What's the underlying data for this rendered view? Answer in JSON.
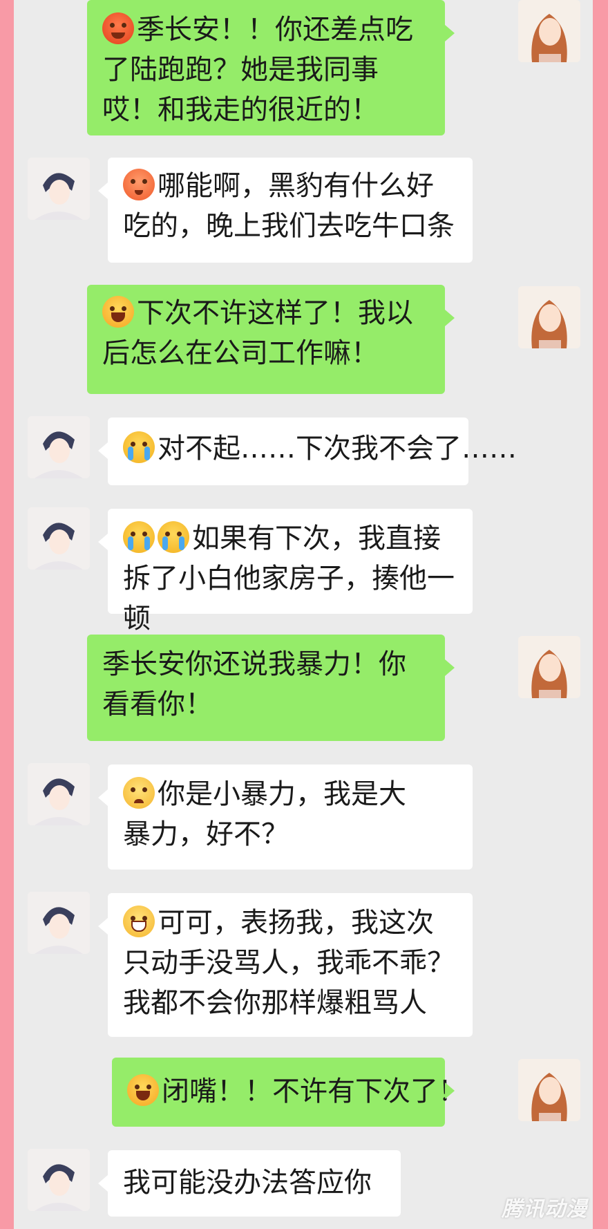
{
  "colors": {
    "sent_bubble": "#95ec69",
    "received_bubble": "#ffffff",
    "chat_background": "#ebebeb",
    "side_border": "#f89aa6"
  },
  "messages": [
    {
      "sender": "me",
      "emoji": "angry-face-icon",
      "text": "季长安！！你还差点吃了陆跑跑？她是我同事哎！和我走的很近的！"
    },
    {
      "sender": "them",
      "emoji": "flushed-face-icon",
      "text": "哪能啊，黑豹有什么好吃的，晚上我们去吃牛口条"
    },
    {
      "sender": "me",
      "emoji": "shouting-face-icon",
      "text": "下次不许这样了！我以后怎么在公司工作嘛！"
    },
    {
      "sender": "them",
      "emoji": "crying-face-icon",
      "text": "对不起……下次我不会了……"
    },
    {
      "sender": "them",
      "emoji": "crying-face-icon-pair",
      "text": "如果有下次，我直接拆了小白他家房子，揍他一顿"
    },
    {
      "sender": "me",
      "emoji": "",
      "text": "季长安你还说我暴力！你看看你！"
    },
    {
      "sender": "them",
      "emoji": "pouting-face-icon",
      "text": "你是小暴力，我是大暴力，好不？"
    },
    {
      "sender": "them",
      "emoji": "grinning-face-icon",
      "text": "可可，表扬我，我这次只动手没骂人，我乖不乖？我都不会你那样爆粗骂人"
    },
    {
      "sender": "me",
      "emoji": "shouting-face-icon",
      "text": "闭嘴！！不许有下次了！"
    },
    {
      "sender": "them",
      "emoji": "",
      "text": "我可能没办法答应你"
    }
  ],
  "watermark": "腾讯动漫"
}
